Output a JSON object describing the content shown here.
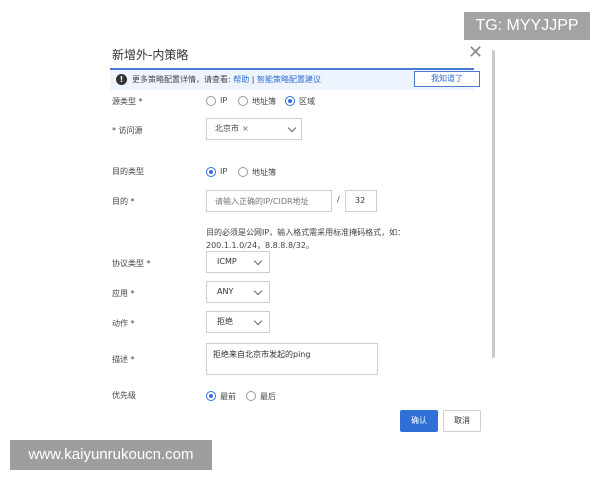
{
  "overlay": {
    "tg": "TG: MYYJJPP",
    "url": "www.kaiyunrukoucn.com"
  },
  "dialog": {
    "title": "新增外-内策略",
    "notice": {
      "prefix": "更多策略配置详情，请查看:",
      "help_link": "帮助",
      "separator": " | ",
      "suggest_link": "智能策略配置建议",
      "known_button": "我知道了"
    },
    "source_type": {
      "label": "源类型 *",
      "options": [
        "IP",
        "地址簿",
        "区域"
      ],
      "selected": "区域"
    },
    "visit_source": {
      "label": "* 访问源",
      "chip": "北京市",
      "chip_close": "×"
    },
    "dest_type": {
      "label": "目的类型",
      "options": [
        "IP",
        "地址簿"
      ],
      "selected": "IP"
    },
    "destination": {
      "label": "目的 *",
      "placeholder": "请输入正确的IP/CIDR地址",
      "slash": "/",
      "mask": "32",
      "hint": "目的必须是公网IP，输入格式需采用标准掩码格式，如： 200.1.1.0/24，8.8.8.8/32。"
    },
    "protocol": {
      "label": "协议类型 *",
      "value": "ICMP"
    },
    "application": {
      "label": "应用 *",
      "value": "ANY"
    },
    "action": {
      "label": "动作 *",
      "value": "拒绝"
    },
    "description": {
      "label": "描述 *",
      "value": "拒绝来自北京市发起的ping"
    },
    "priority": {
      "label": "优先级",
      "options": [
        "最前",
        "最后"
      ],
      "selected": "最前"
    },
    "confirm_label": "确认",
    "cancel_label": "取消"
  },
  "colors": {
    "primary": "#2f6fd6",
    "notice_bg": "#eef4fd"
  }
}
